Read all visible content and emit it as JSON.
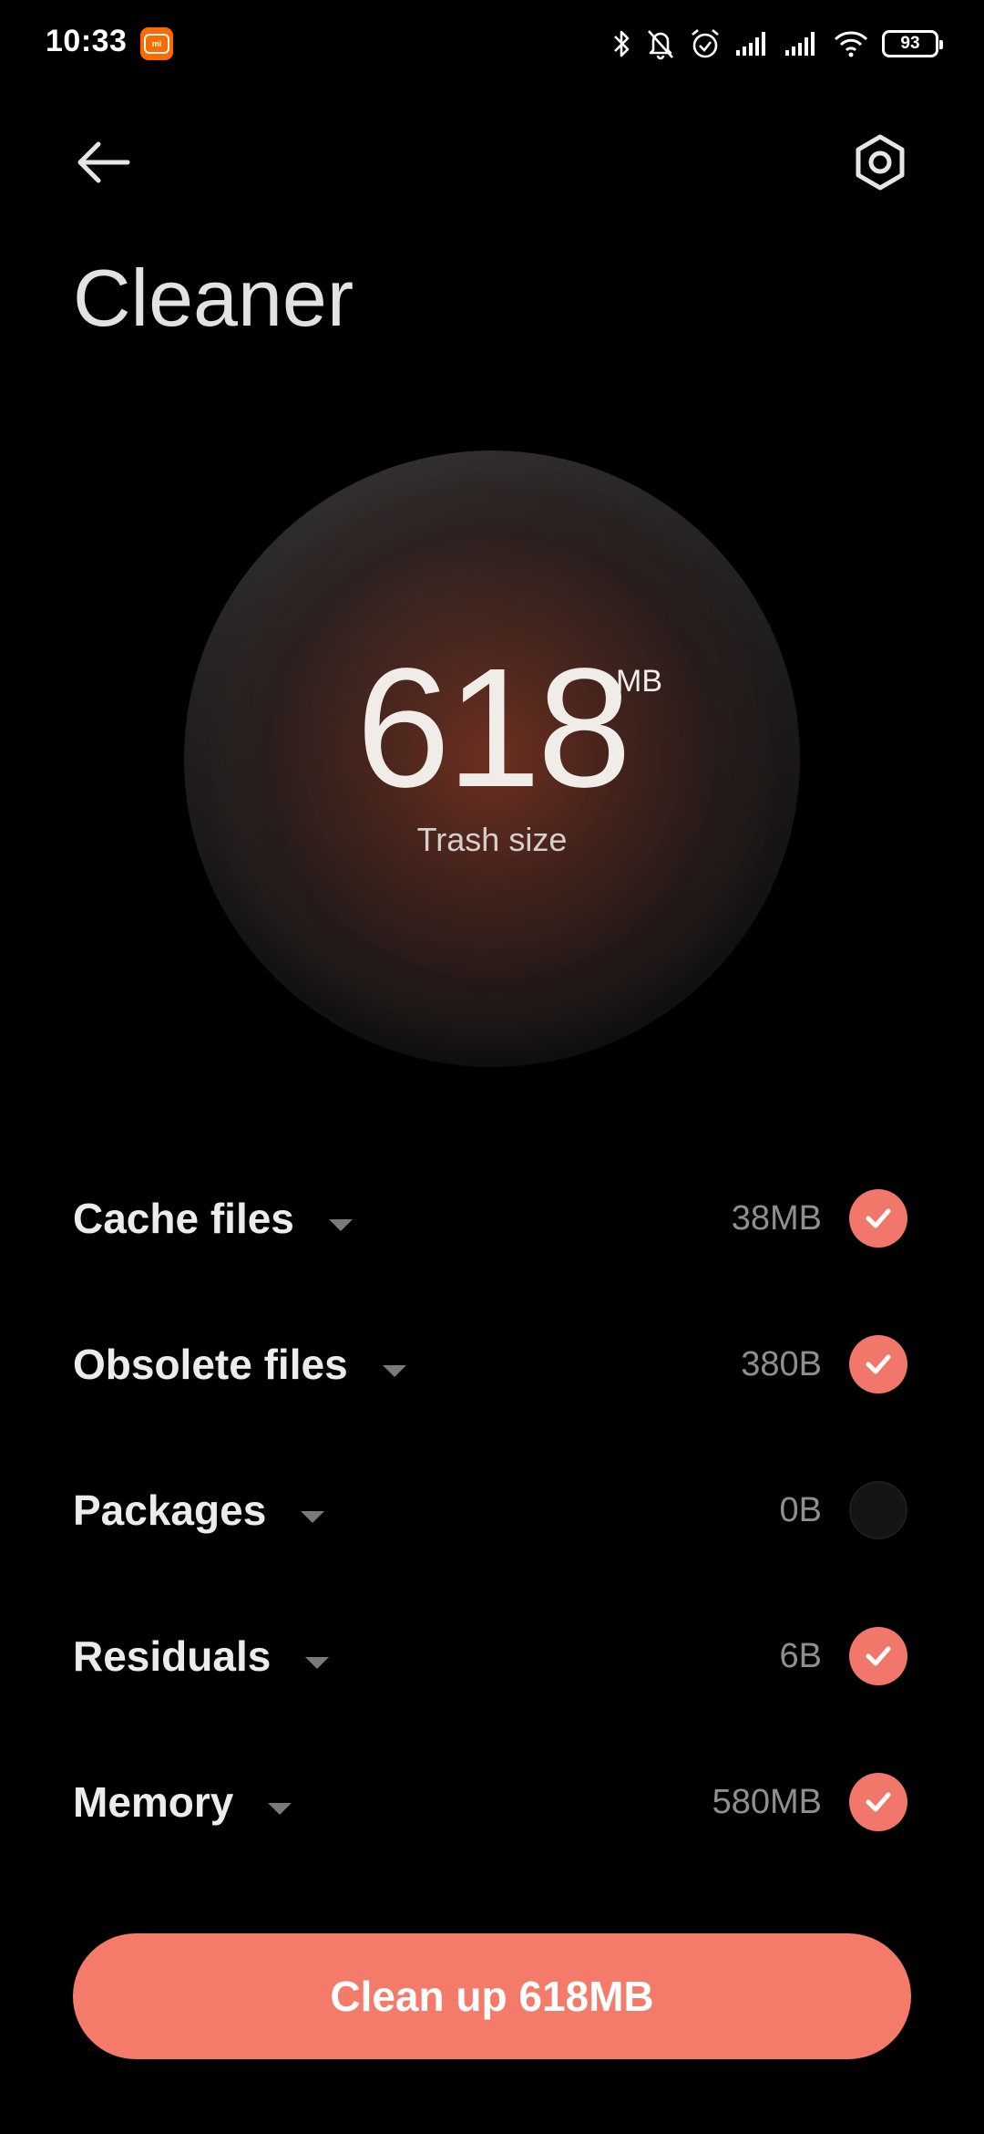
{
  "status_bar": {
    "time": "10:33",
    "battery": "93",
    "icons": [
      "bluetooth-icon",
      "bell-muted-icon",
      "alarm-icon",
      "signal-icon",
      "signal-icon",
      "wifi-icon",
      "battery-icon"
    ]
  },
  "header": {
    "title": "Cleaner",
    "back_icon": "arrow-left-icon",
    "settings_icon": "hexagon-gear-icon"
  },
  "summary": {
    "value": "618",
    "unit": "MB",
    "caption": "Trash size"
  },
  "items": [
    {
      "label": "Cache files",
      "size": "38MB",
      "checked": true
    },
    {
      "label": "Obsolete files",
      "size": "380B",
      "checked": true
    },
    {
      "label": "Packages",
      "size": "0B",
      "checked": false
    },
    {
      "label": "Residuals",
      "size": "6B",
      "checked": true
    },
    {
      "label": "Memory",
      "size": "580MB",
      "checked": true
    }
  ],
  "action": {
    "label": "Clean up 618MB"
  },
  "colors": {
    "accent": "#f47b69",
    "check": "#f0776a",
    "background": "#000000"
  }
}
